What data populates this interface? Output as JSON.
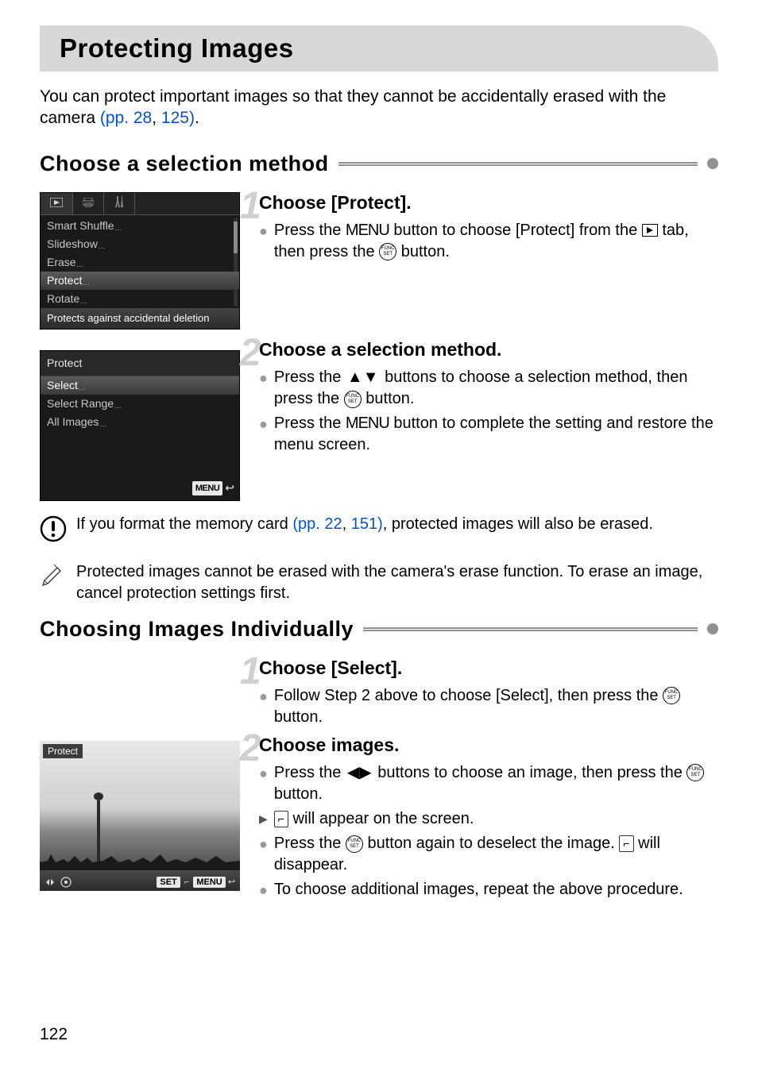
{
  "title": "Protecting Images",
  "intro": {
    "text1": "You can protect important images so that they cannot be accidentally erased with the camera ",
    "link1": "(pp. 28",
    "linksep": ", ",
    "link2": "125)",
    "tail": "."
  },
  "section1": {
    "heading": "Choose a selection method",
    "lcd1": {
      "items": [
        "Smart Shuffle",
        "Slideshow",
        "Erase",
        "Protect",
        "Rotate"
      ],
      "selected": "Protect",
      "help": "Protects against accidental deletion"
    },
    "lcd2": {
      "title": "Protect",
      "items": [
        "Select",
        "Select Range",
        "All Images"
      ],
      "selected": "Select",
      "footer": "MENU"
    },
    "step1": {
      "num": "1",
      "title": "Choose [Protect].",
      "b1a": "Press the ",
      "menu": "MENU",
      "b1b": " button to choose [Protect] from the ",
      "b1c": " tab, then press the ",
      "b1d": " button."
    },
    "step2": {
      "num": "2",
      "title": "Choose a selection method.",
      "b1a": "Press the ",
      "b1b": " buttons to choose a selection method, then press the ",
      "b1c": " button.",
      "b2a": "Press the ",
      "menu": "MENU",
      "b2b": " button to complete the setting and restore the menu screen."
    }
  },
  "note1": {
    "a": "If you format the memory card ",
    "link1": "(pp. 22",
    "sep": ", ",
    "link2": "151)",
    "b": ", protected images will also be erased."
  },
  "note2": "Protected images cannot be erased with the camera's erase function. To erase an image, cancel protection settings first.",
  "section2": {
    "heading": "Choosing Images Individually",
    "photo": {
      "badge": "Protect",
      "set": "SET",
      "menu": "MENU"
    },
    "step1": {
      "num": "1",
      "title": "Choose [Select].",
      "b1a": "Follow Step 2 above to choose [Select], then press the ",
      "b1b": " button."
    },
    "step2": {
      "num": "2",
      "title": "Choose images.",
      "b1a": "Press the ",
      "b1b": " buttons to choose an image, then press the ",
      "b1c": " button.",
      "b2": " will appear on the screen.",
      "b3a": "Press the ",
      "b3b": " button again to deselect the image. ",
      "b3c": " will disappear.",
      "b4": "To choose additional images, repeat the above procedure."
    }
  },
  "pageNum": "122"
}
